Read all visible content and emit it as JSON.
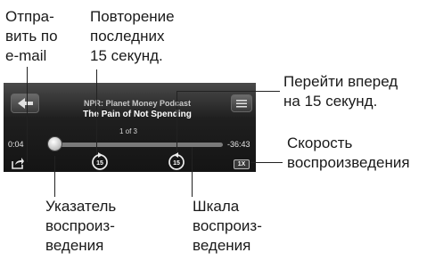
{
  "callouts": {
    "email": "Отпра-\nвить по\ne-mail",
    "replay": "Повторение\nпоследних\n15 секунд.",
    "skip_forward": "Перейти вперед\nна 15 секунд.",
    "speed": "Скорость\nвоспроизведения",
    "playhead": "Указатель\nвоспроиз-\nведения",
    "scrubber": "Шкала\nвоспроиз-\nведения"
  },
  "player": {
    "podcast_name": "NPR: Planet Money Podcast",
    "episode_title": "The Pain of Not Spending",
    "episode_count": "1 of 3",
    "elapsed": "0:04",
    "remaining": "-36:43",
    "skip_seconds": "15",
    "speed": "1X",
    "progress_fraction": 0.02
  }
}
